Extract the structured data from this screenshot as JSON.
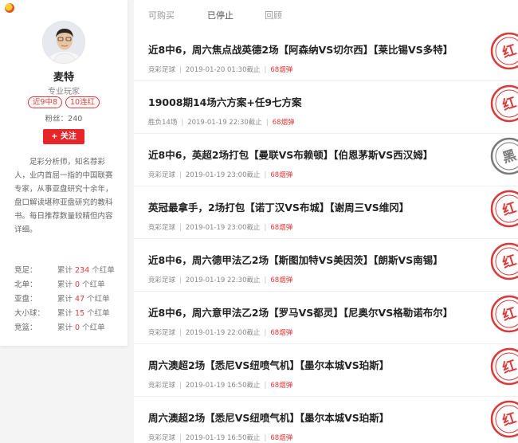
{
  "profile": {
    "name": "麦特",
    "role": "专业玩家",
    "badges": [
      "近9中8",
      "10连红"
    ],
    "fans_label": "粉丝：240",
    "follow_label": "+ 关注",
    "bio": "足彩分析师，知名荐彩人，业内首屈一指的中国联赛专家，从事亚盘研究十余年，盘口解读堪称亚盘研究的教科书。每日推荐数量较精但内容详细。",
    "stats": [
      {
        "label": "竞足：",
        "prefix": "累计 ",
        "value": "234",
        "suffix": " 个红单"
      },
      {
        "label": "北单：",
        "prefix": "累计 ",
        "value": "0",
        "suffix": " 个红单"
      },
      {
        "label": "亚盘：",
        "prefix": "累计 ",
        "value": "47",
        "suffix": " 个红单"
      },
      {
        "label": "大小球：",
        "prefix": "累计 ",
        "value": "15",
        "suffix": " 个红单"
      },
      {
        "label": "竞篮：",
        "prefix": "累计 ",
        "value": "0",
        "suffix": " 个红单"
      }
    ]
  },
  "tabs": [
    "可购买",
    "已停止",
    "回顾"
  ],
  "active_tab": "已停止",
  "colors": {
    "red": "#e23a3a",
    "stamp_red": "#d93b3b",
    "stamp_black": "#7a7a7a"
  },
  "items": [
    {
      "title": "近8中6，周六焦点战英德2场【阿森纳VS切尔西】【莱比锡VS多特】",
      "type": "竞彩足球",
      "time": "2019-01-20 01:30截止",
      "price": "68烟弹",
      "stamp": "红"
    },
    {
      "title": "19008期14场六方案+任9七方案",
      "type": "胜负14场",
      "time": "2019-01-19 22:30截止",
      "price": "68烟弹",
      "stamp": "红"
    },
    {
      "title": "近8中6，英超2场打包【曼联VS布赖顿】【伯恩茅斯VS西汉姆】",
      "type": "竞彩足球",
      "time": "2019-01-19 23:00截止",
      "price": "68烟弹",
      "stamp": "黑"
    },
    {
      "title": "英冠最拿手，2场打包【诺丁汉VS布城】【谢周三VS维冈】",
      "type": "竞彩足球",
      "time": "2019-01-19 23:00截止",
      "price": "68烟弹",
      "stamp": "红"
    },
    {
      "title": "近8中6，周六德甲法乙2场【斯图加特VS美因茨】【朗斯VS南锡】",
      "type": "竞彩足球",
      "time": "2019-01-19 22:30截止",
      "price": "68烟弹",
      "stamp": "红"
    },
    {
      "title": "近8中6，周六意甲法乙2场【罗马VS都灵】【尼奥尔VS格勒诺布尔】",
      "type": "竞彩足球",
      "time": "2019-01-19 22:00截止",
      "price": "68烟弹",
      "stamp": "红"
    },
    {
      "title": "周六澳超2场【悉尼VS纽喷气机】【墨尔本城VS珀斯】",
      "type": "竞彩足球",
      "time": "2019-01-19 16:50截止",
      "price": "68烟弹",
      "stamp": "红"
    },
    {
      "title": "周六澳超2场【悉尼VS纽喷气机】【墨尔本城VS珀斯】",
      "type": "竞彩足球",
      "time": "2019-01-19 16:50截止",
      "price": "68烟弹",
      "stamp": "红"
    }
  ]
}
